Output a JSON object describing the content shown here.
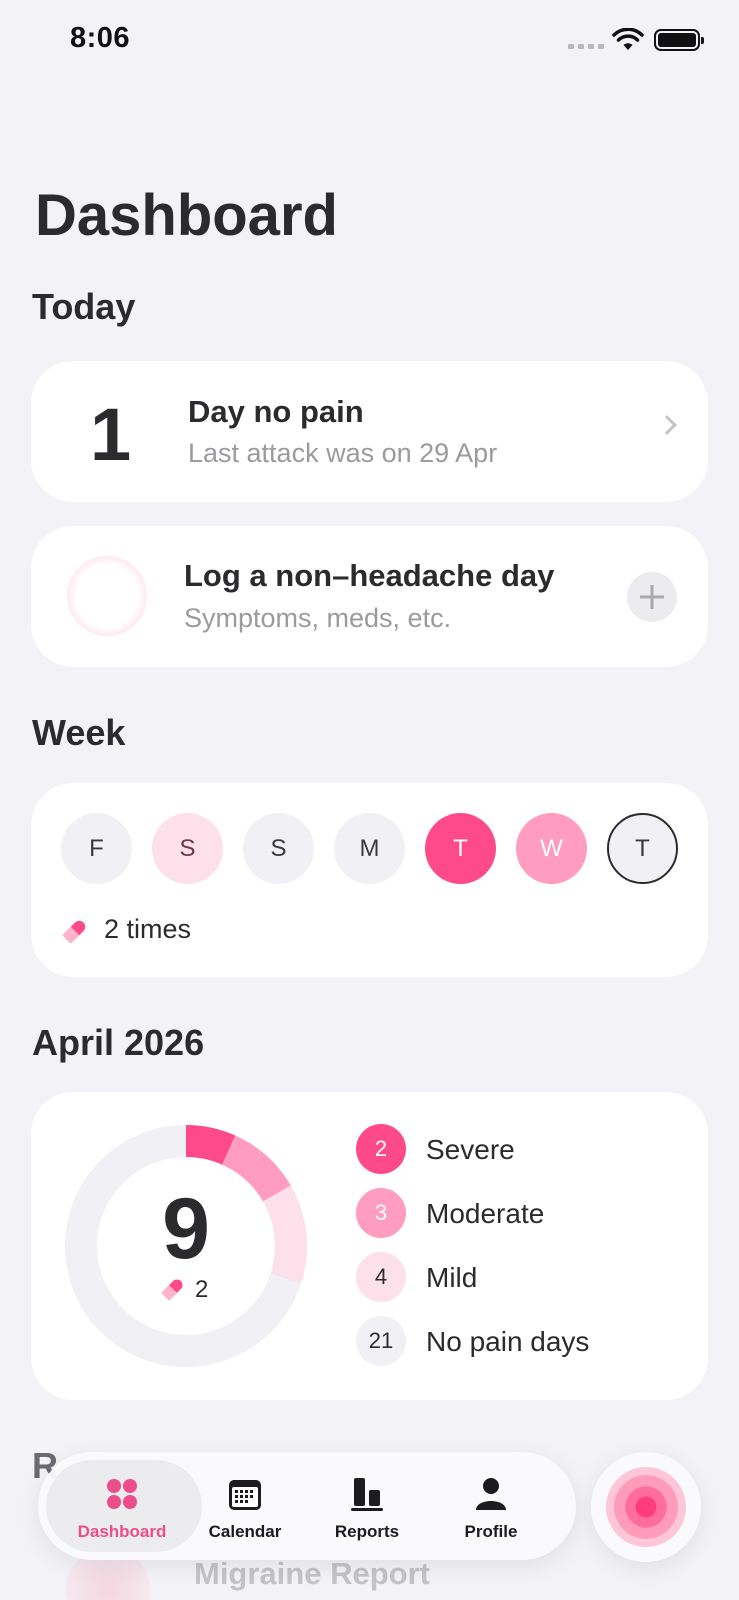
{
  "status": {
    "time": "8:06"
  },
  "page_title": "Dashboard",
  "today": {
    "section": "Today",
    "days_count": "1",
    "title": "Day no pain",
    "subtitle": "Last attack was on 29 Apr"
  },
  "log": {
    "title": "Log a non–headache day",
    "subtitle": "Symptoms, meds, etc."
  },
  "week": {
    "section": "Week",
    "days": [
      "F",
      "S",
      "S",
      "M",
      "T",
      "W",
      "T"
    ],
    "meds": "2 times"
  },
  "month": {
    "section": "April 2026",
    "total": "9",
    "meds": "2",
    "legend": [
      {
        "count": "2",
        "label": "Severe",
        "color": "#ff4a8a"
      },
      {
        "count": "3",
        "label": "Moderate",
        "color": "#ff9cc0"
      },
      {
        "count": "4",
        "label": "Mild",
        "color": "#fde0ea"
      },
      {
        "count": "21",
        "label": "No pain days",
        "color": "#f0f0f5"
      }
    ]
  },
  "below": {
    "section_partial": "R",
    "row_title": "Migraine Report"
  },
  "tabbar": {
    "tabs": [
      {
        "label": "Dashboard",
        "icon": "grid-icon"
      },
      {
        "label": "Calendar",
        "icon": "calendar-icon"
      },
      {
        "label": "Reports",
        "icon": "bar-chart-icon"
      },
      {
        "label": "Profile",
        "icon": "person-icon"
      }
    ]
  },
  "colors": {
    "accent": "#ec4d8b",
    "severe": "#ff4a8a",
    "moderate": "#ff9cc0",
    "mild": "#fde0ea",
    "background": "#f2f2f7"
  }
}
